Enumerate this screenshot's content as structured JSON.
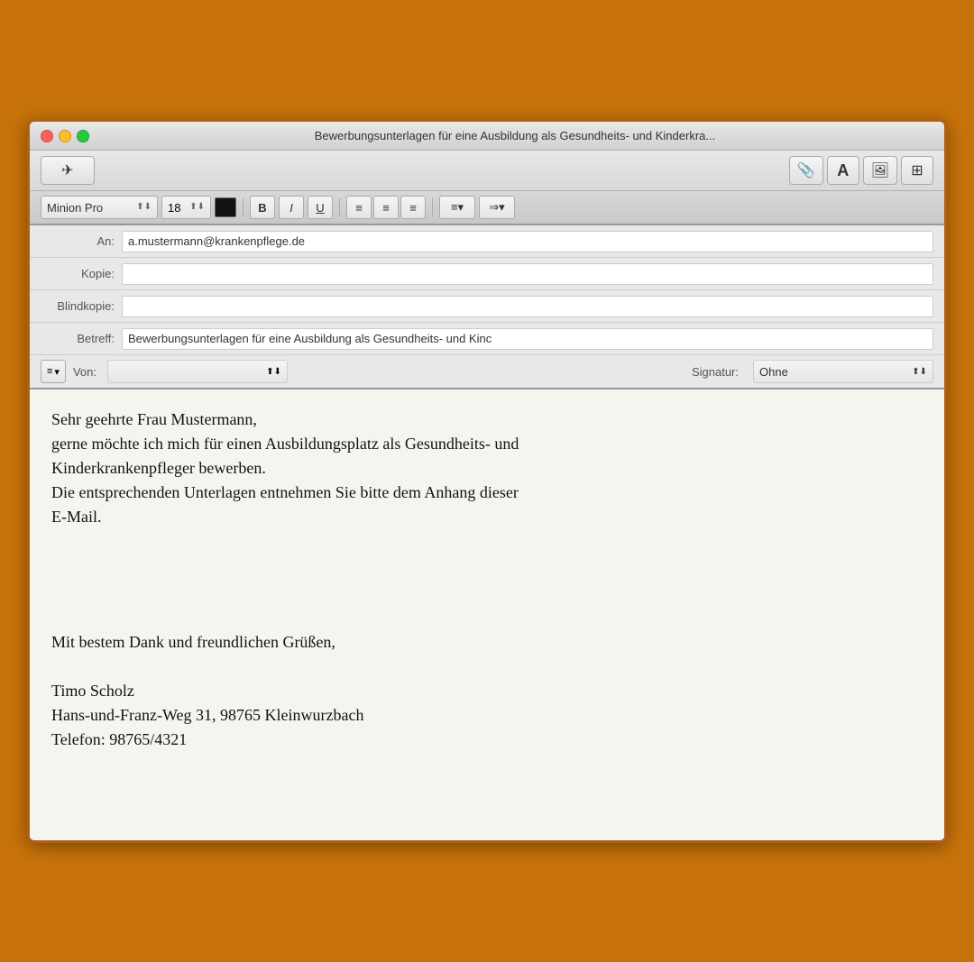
{
  "window": {
    "title": "Bewerbungsunterlagen für eine Ausbildung als Gesundheits- und Kinderkra...",
    "titleShort": "Bewerbungsunterlagen für eine Ausbildung als Gesundheits- und Kinderkra..."
  },
  "toolbar": {
    "send_label": "Send",
    "send_icon": "✈",
    "attachment_icon": "📎",
    "font_icon": "A",
    "image_icon": "⊞",
    "table_icon": "⊟"
  },
  "format_toolbar": {
    "font_name": "Minion Pro",
    "font_size": "18",
    "bold_label": "B",
    "italic_label": "I",
    "underline_label": "U"
  },
  "header": {
    "to_label": "An:",
    "to_value": "a.mustermann@krankenpflege.de",
    "cc_label": "Kopie:",
    "cc_value": "",
    "bcc_label": "Blindkopie:",
    "bcc_value": "",
    "subject_label": "Betreff:",
    "subject_value": "Bewerbungsunterlagen für eine Ausbildung als Gesundheits- und Kinc",
    "from_label": "Von:",
    "from_value": "",
    "signature_label": "Signatur:",
    "signature_value": "Ohne"
  },
  "body": {
    "greeting": "Sehr geehrte Frau Mustermann,",
    "paragraph1_line1": "gerne möchte ich mich für einen Ausbildungsplatz als Gesundheits- und",
    "paragraph1_line2": "Kinderkrankenpfleger bewerben.",
    "paragraph1_line3": "Die entsprechenden Unterlagen entnehmen Sie bitte dem Anhang dieser",
    "paragraph1_line4": "E-Mail.",
    "closing": "Mit bestem Dank und freundlichen Grüßen,",
    "sig_name": "Timo Scholz",
    "sig_address": "Hans-und-Franz-Weg 31, 98765 Kleinwurzbach",
    "sig_phone": "Telefon: 98765/4321"
  },
  "colors": {
    "background": "#c8730a",
    "window_bg": "#f0f0f0",
    "body_bg": "#f5f5f0",
    "toolbar_bg": "#d8d8d8"
  }
}
